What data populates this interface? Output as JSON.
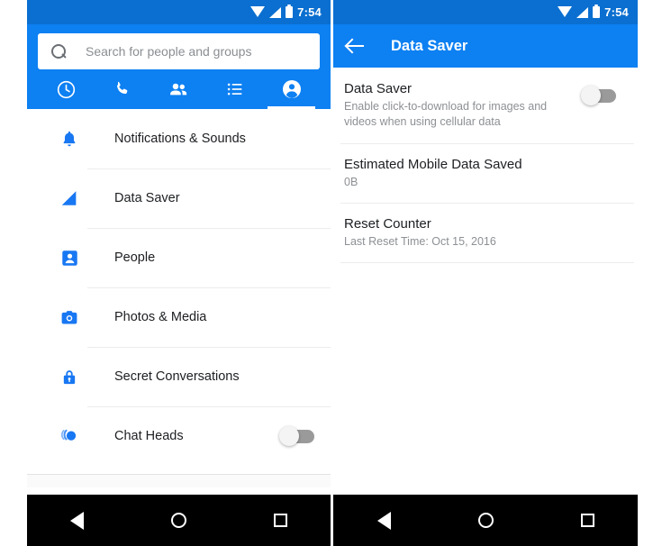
{
  "status_bar": {
    "time": "7:54",
    "icons": [
      "wifi-icon",
      "cellular-signal-icon",
      "battery-icon"
    ]
  },
  "colors": {
    "brand_blue": "#0d80f2",
    "status_bar_blue": "#0a6fd0",
    "icon_blue": "#1877f2",
    "toggle_off_track": "#9a9a9a",
    "divider": "#ececec",
    "primary_text": "#1c1e21",
    "secondary_text": "#8d9094"
  },
  "left_panel": {
    "search": {
      "placeholder": "Search for people and groups",
      "icon": "search-icon",
      "value": ""
    },
    "tabs": [
      {
        "name": "recent",
        "icon": "clock-icon",
        "active": false
      },
      {
        "name": "calls",
        "icon": "phone-icon",
        "active": false
      },
      {
        "name": "people",
        "icon": "group-icon",
        "active": false
      },
      {
        "name": "lists",
        "icon": "list-icon",
        "active": false
      },
      {
        "name": "profile",
        "icon": "person-circle-icon",
        "active": true
      }
    ],
    "settings_items": [
      {
        "label": "Notifications & Sounds",
        "icon": "bell-icon",
        "toggle": null
      },
      {
        "label": "Data Saver",
        "icon": "signal-triangle-icon",
        "toggle": null
      },
      {
        "label": "People",
        "icon": "contact-card-icon",
        "toggle": null
      },
      {
        "label": "Photos & Media",
        "icon": "camera-icon",
        "toggle": null
      },
      {
        "label": "Secret Conversations",
        "icon": "lock-icon",
        "toggle": null
      },
      {
        "label": "Chat Heads",
        "icon": "chat-heads-icon",
        "toggle": "off"
      }
    ]
  },
  "right_panel": {
    "appbar": {
      "back_icon": "back-arrow-icon",
      "title": "Data Saver"
    },
    "preferences": [
      {
        "title": "Data Saver",
        "subtitle": "Enable click-to-download for images and videos when using cellular data",
        "toggle": "off"
      },
      {
        "title": "Estimated Mobile Data Saved",
        "subtitle": "0B",
        "toggle": null
      },
      {
        "title": "Reset Counter",
        "subtitle": "Last Reset Time: Oct 15, 2016",
        "toggle": null
      }
    ]
  },
  "nav_bar": {
    "buttons": [
      {
        "name": "back",
        "icon": "triangle-back-icon"
      },
      {
        "name": "home",
        "icon": "circle-home-icon"
      },
      {
        "name": "recents",
        "icon": "square-recents-icon"
      }
    ]
  }
}
